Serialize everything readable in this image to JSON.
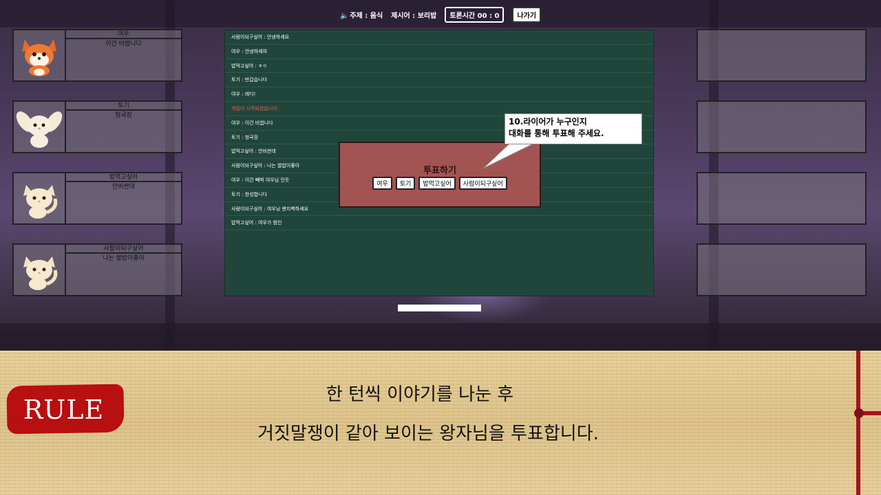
{
  "topbar": {
    "topic": "주제 : 음식",
    "keyword": "제시어 : 보리밥",
    "timer": "토론시간 00 : 0",
    "exit_label": "나가기"
  },
  "players": [
    {
      "name": "여우",
      "message": "이건 비쌉니다",
      "animal": "fox"
    },
    {
      "name": "토기",
      "message": "청국장",
      "animal": "rabbit"
    },
    {
      "name": "밥먹고싶어",
      "message": "안비싼데",
      "animal": "cat"
    },
    {
      "name": "사람이되구싶어",
      "message": "나는 쌀밥이좋아",
      "animal": "cat"
    }
  ],
  "chat": [
    {
      "text": "사람이되구싶어 : 안녕하세요",
      "system": false
    },
    {
      "text": "여우 : 안녕하세여",
      "system": false
    },
    {
      "text": "밥먹고싶어 : ㅎㅇ",
      "system": false
    },
    {
      "text": "토기 : 반갑습니다",
      "system": false
    },
    {
      "text": "여우 : 레디!",
      "system": false
    },
    {
      "text": "게임이 시작되었습니다.",
      "system": true
    },
    {
      "text": "여우 : 이건 비쌉니다",
      "system": false
    },
    {
      "text": "토기 : 청국장",
      "system": false
    },
    {
      "text": "밥먹고싶어 : 안비싼데",
      "system": false
    },
    {
      "text": "사람이되구싶어 : 나는 쌀밥이좋아",
      "system": false
    },
    {
      "text": "여우 : 이건 빼박 여우님 인듯",
      "system": false
    },
    {
      "text": "토기 : 찬성합니다",
      "system": false
    },
    {
      "text": "사람이되구싶어 : 여우님 왠지벽하세요",
      "system": false
    },
    {
      "text": "밥먹고싶어 : 여우가 범인",
      "system": false
    }
  ],
  "vote": {
    "title": "투표하기",
    "options": [
      "여우",
      "토기",
      "밥먹고싶어",
      "사람이되구싶어"
    ]
  },
  "bubble": {
    "line1": "10.라이어가 누구인지",
    "line2": "대화를 통해 투표해 주세요."
  },
  "rule": {
    "badge": "RULE",
    "line1": "한 턴씩 이야기를 나눈 후",
    "line2": "거짓말쟁이 같아 보이는 왕자님을 투표합니다."
  },
  "colors": {
    "chat_bg": "#20463c",
    "vote_bg": "#a25452",
    "system_text": "#ff5a4a",
    "rule_badge": "#b80f10"
  }
}
